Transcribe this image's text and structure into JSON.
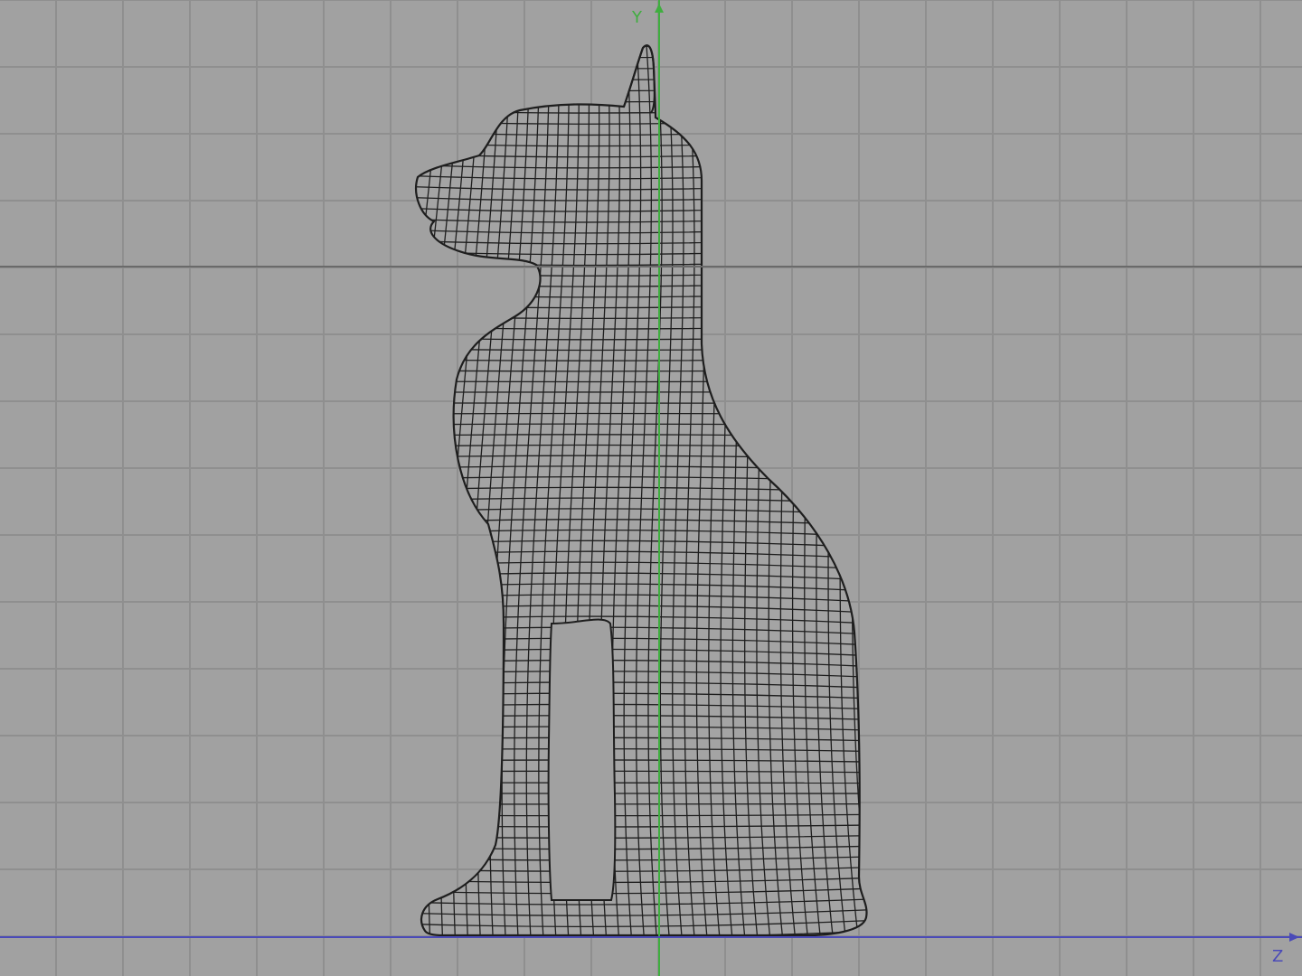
{
  "viewport": {
    "view": "side",
    "axes": {
      "vertical": {
        "label": "Y",
        "color": "#3fae3f"
      },
      "horizontal": {
        "label": "Z",
        "color": "#4a4ab8"
      }
    },
    "colors": {
      "background": "#a1a1a1",
      "grid": "#8f8f8f",
      "grid_major": "#6e6e6e",
      "wireframe": "#1e1e1e"
    },
    "object": {
      "name": "cat-statue",
      "display": "wireframe"
    }
  }
}
